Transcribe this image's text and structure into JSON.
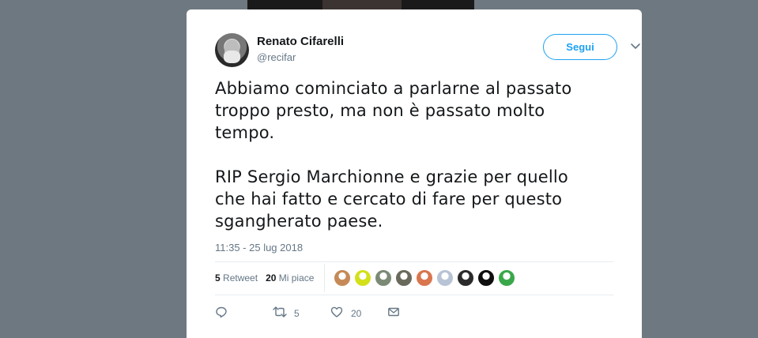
{
  "user": {
    "name": "Renato Cifarelli",
    "handle": "@recifar"
  },
  "follow_label": "Segui",
  "tweet": {
    "text": "Abbiamo cominciato a parlarne al passato\ntroppo presto, ma non è passato molto\ntempo.\n\nRIP Sergio Marchionne e grazie per quello\nche hai fatto e cercato di fare per questo\nsgangherato paese.",
    "timestamp": "11:35 - 25 lug 2018"
  },
  "stats": {
    "retweets_count": "5",
    "retweets_label": "Retweet",
    "likes_count": "20",
    "likes_label": "Mi piace"
  },
  "likers": [
    {
      "icon": "liker-avatar",
      "color": "#c58a57"
    },
    {
      "icon": "liker-avatar",
      "color": "#d4e01a"
    },
    {
      "icon": "liker-avatar",
      "color": "#7b8a74"
    },
    {
      "icon": "liker-avatar",
      "color": "#6a6a5c"
    },
    {
      "icon": "liker-avatar",
      "color": "#d9764d"
    },
    {
      "icon": "liker-avatar",
      "color": "#b8c4d6"
    },
    {
      "icon": "liker-avatar",
      "color": "#2b2b2b"
    },
    {
      "icon": "liker-avatar",
      "color": "#0f0f0f"
    },
    {
      "icon": "liker-avatar",
      "color": "#3aa84a"
    }
  ],
  "actions": {
    "reply_icon": "reply-icon",
    "retweet_icon": "retweet-icon",
    "retweet_count": "5",
    "like_icon": "heart-icon",
    "like_count": "20",
    "dm_icon": "envelope-icon"
  },
  "colors": {
    "accent": "#1da1f2",
    "text": "#14171a",
    "muted": "#657786"
  }
}
